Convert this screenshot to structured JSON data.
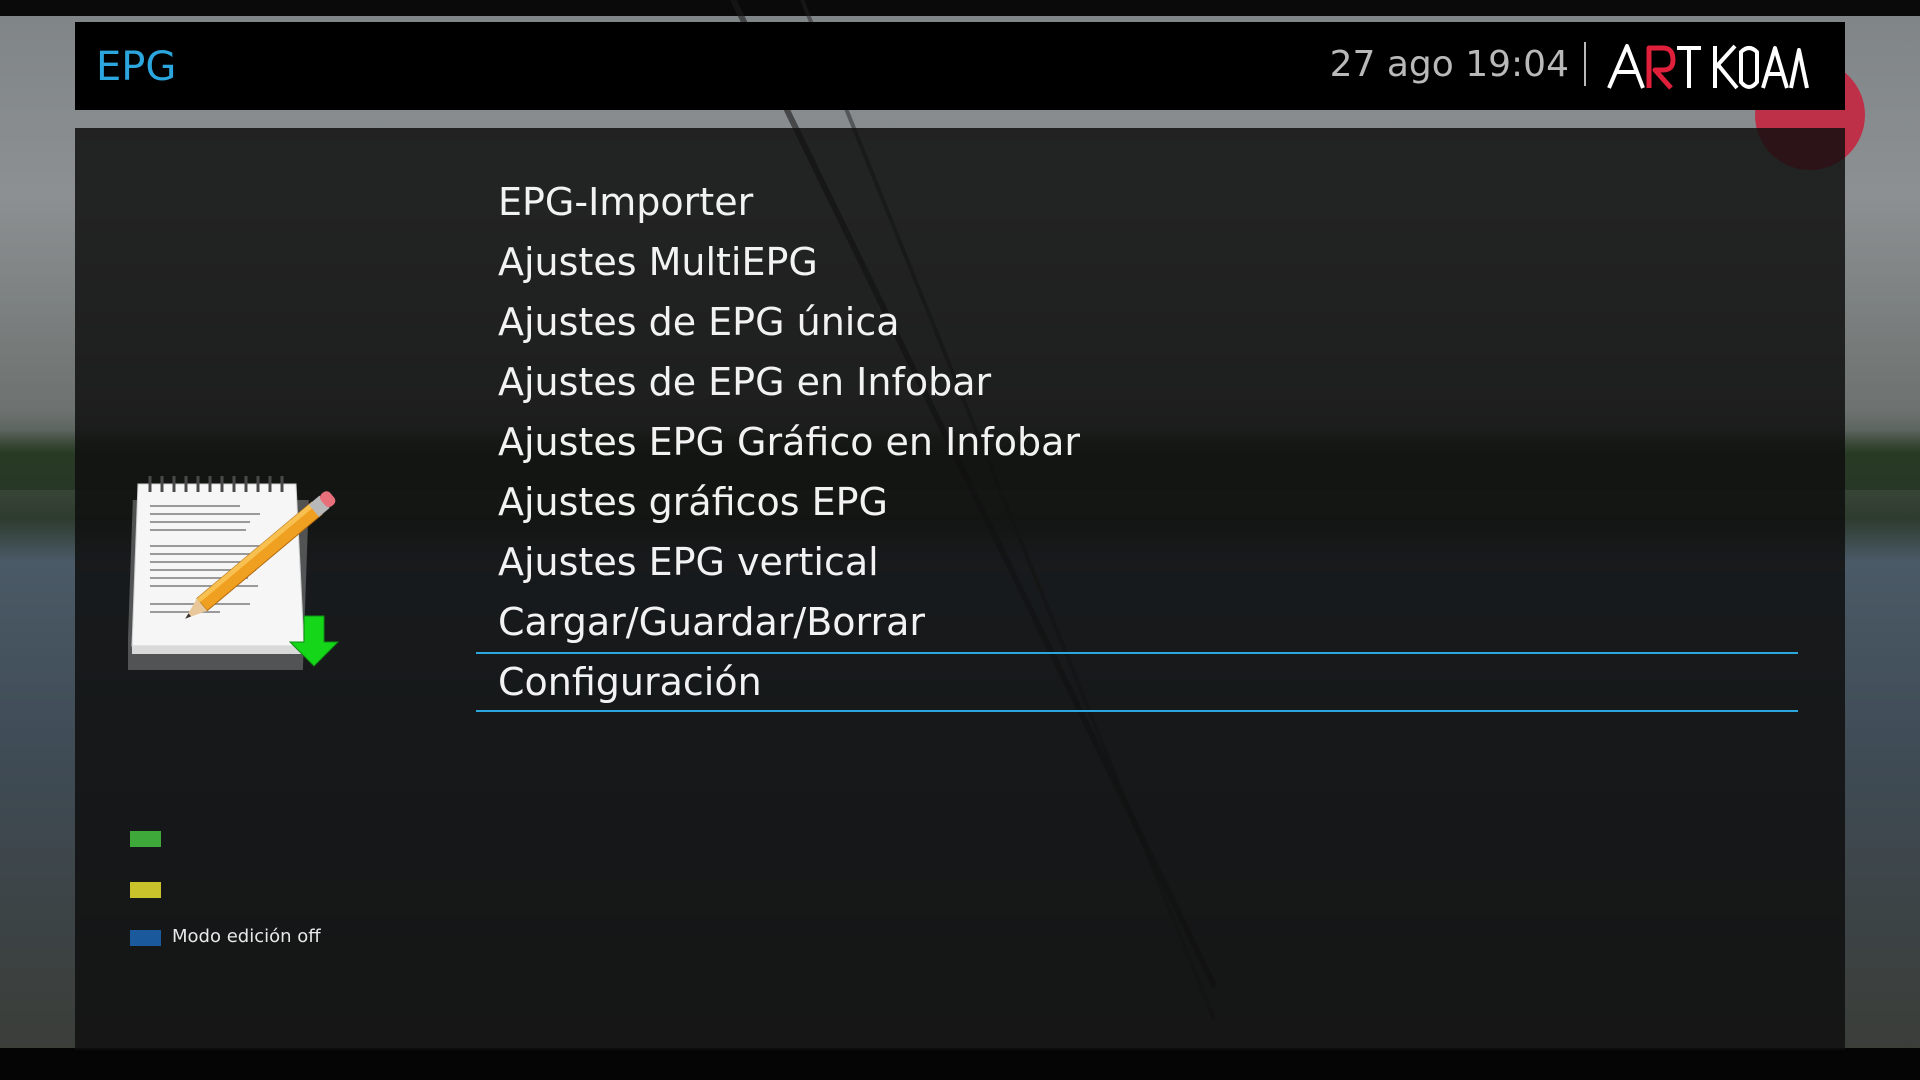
{
  "header": {
    "title": "EPG",
    "datetime": "27 ago 19:04",
    "brand_logo": "ART KOALA"
  },
  "menu": {
    "items": [
      {
        "label": "EPG-Importer"
      },
      {
        "label": "Ajustes MultiEPG"
      },
      {
        "label": "Ajustes de EPG única"
      },
      {
        "label": "Ajustes de EPG en Infobar"
      },
      {
        "label": "Ajustes EPG Gráfico en Infobar"
      },
      {
        "label": "Ajustes gráficos EPG"
      },
      {
        "label": "Ajustes EPG vertical"
      },
      {
        "label": "Cargar/Guardar/Borrar"
      },
      {
        "label": "Configuración"
      }
    ],
    "selected_index": 8
  },
  "icon": "notepad-pencil-download-icon",
  "keys": {
    "green": {
      "color": "#3fa83a",
      "label": ""
    },
    "yellow": {
      "color": "#c9c22a",
      "label": ""
    },
    "blue": {
      "color": "#1a5a9c",
      "label": "Modo edición off"
    }
  },
  "colors": {
    "accent": "#2ba6de",
    "text": "#f2f2f2",
    "clock": "#b9b9b9"
  }
}
